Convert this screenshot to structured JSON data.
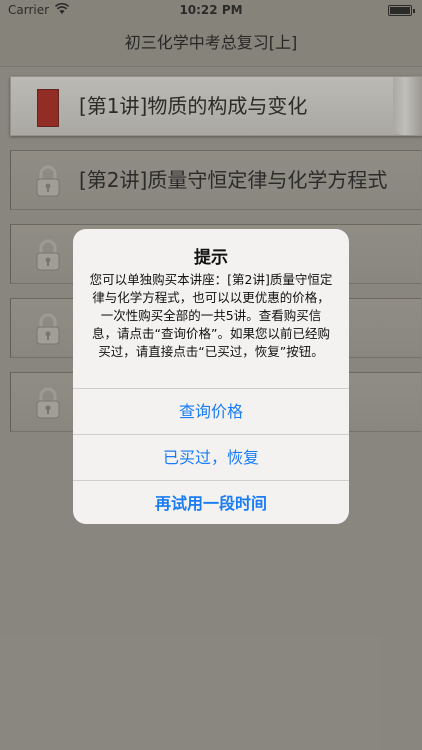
{
  "status_bar": {
    "carrier": "Carrier",
    "time": "10:22 PM"
  },
  "nav": {
    "title": "初三化学中考总复习[上]"
  },
  "lessons": [
    {
      "label": "[第1讲]物质的构成与变化",
      "locked": false
    },
    {
      "label": "[第2讲]质量守恒定律与化学方程式",
      "locked": true
    },
    {
      "label": "",
      "locked": true
    },
    {
      "label": "",
      "locked": true
    },
    {
      "label": "",
      "locked": true
    }
  ],
  "alert": {
    "title": "提示",
    "message": "您可以单独购买本讲座：[第2讲]质量守恒定律与化学方程式，也可以以更优惠的价格，一次性购买全部的一共5讲。查看购买信息，请点击“查询价格”。如果您以前已经购买过，请直接点击“已买过，恢复”按钮。",
    "buttons": [
      "查询价格",
      "已买过，恢复",
      "再试用一段时间"
    ]
  },
  "colors": {
    "accent": "#1a7cf5",
    "book": "#b3231b"
  }
}
